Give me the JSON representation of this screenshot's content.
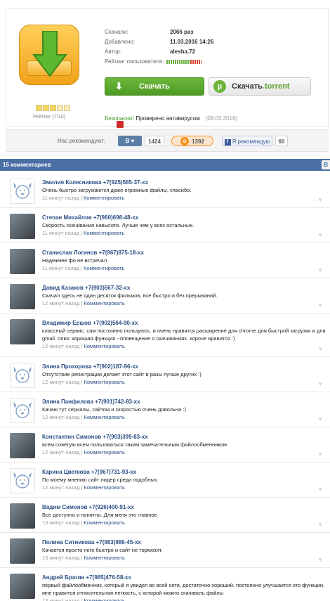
{
  "file": {
    "stats": [
      {
        "key": "Скачали:",
        "value": "2066 раз"
      },
      {
        "key": "Добавлено:",
        "value": "11.03.2016 14:26"
      },
      {
        "key": "Автор:",
        "value": "alesha.72"
      }
    ],
    "user_rating_label": "Рейтинг пользователя:",
    "user_rating_fraction": 0.7,
    "rating_text": "Рейтинг (7/10)",
    "rating_stars_on": 3,
    "rating_stars_total": 5
  },
  "buttons": {
    "download_label": "Скачать",
    "download_icon": "download-arrow-icon",
    "torrent_label_a": "Скачать ",
    "torrent_label_b": ".torrent",
    "torrent_icon": "utorrent-icon"
  },
  "safety": {
    "safe_word": "Безопасно!",
    "checked_text": "Проверено антивирусом",
    "date": "(08.03.2016)",
    "antivirus_colors": [
      "#d52b1e",
      "#f39c12",
      "#2eab4b",
      "#d22a2a"
    ]
  },
  "share": {
    "label": "Нас рекомендуют:",
    "vk_label": "В ♥",
    "vk_count": "1424",
    "ok_count": "1392",
    "fb_label": "Я рекомендую",
    "fb_count": "60"
  },
  "comments_header": {
    "title": "15 комментариев",
    "badge": "В"
  },
  "reply_label": "Комментировать",
  "comments": [
    {
      "name": "Эмилия Колесникова +7(925)585-37-xx",
      "text": "Очень быстро загружаются даже огромные файлы, спасибо.",
      "time": "11 минут назад",
      "avatar": "dog"
    },
    {
      "name": "Степан Михайлов +7(980)698-48-xx",
      "text": "Скорость скачивания навысоте. Лучше чем у всех остальных.",
      "time": "11 минут назад",
      "avatar": "photo"
    },
    {
      "name": "Станислав Логинов +7(967)875-18-xx",
      "text": "Надежнее фо не встречал",
      "time": "11 минут назад",
      "avatar": "photo"
    },
    {
      "name": "Давид Казаков +7(903)567-32-xx",
      "text": "Скачал здесь не один десяток фильмов, все быстро и без прерываний.",
      "time": "12 минут назад",
      "avatar": "photo"
    },
    {
      "name": "Владимир Ершов +7(902)564-90-xx",
      "text": "классный сервис. сам постоянно пользуюсь. и очень нравятся расширение для chrome для быстрой загрузки и для gmail. плюс хорошая функция - оповещение о скачиваниях. короче нравится :)",
      "time": "12 минут назад",
      "avatar": "photo"
    },
    {
      "name": "Элина Прохорова +7(902)187-96-xx",
      "text": "Отсутствие регистрации делает этот сайт в разы лучше других :)",
      "time": "12 минут назад",
      "avatar": "dog"
    },
    {
      "name": "Элина Панфилова +7(901)742-83-xx",
      "text": "Качаю тут сериалы, сайтом и скоростью очень довольна :)",
      "time": "12 минут назад",
      "avatar": "dog"
    },
    {
      "name": "Константин Симонов +7(903)399-83-xx",
      "text": "всем советую всем пользоваться таким замечательным файлообменником",
      "time": "12 минут назад",
      "avatar": "photo"
    },
    {
      "name": "Карина Цветкова +7(967)731-93-xx",
      "text": "По моему мнению сайт лидер среди подобных.",
      "time": "12 минут назад",
      "avatar": "dog"
    },
    {
      "name": "Вадим Симонов +7(926)400-91-xx",
      "text": "Все доступно и понятно. Для меня это главное",
      "time": "13 минут назад",
      "avatar": "photo"
    },
    {
      "name": "Полина Ситникова +7(983)986-45-xx",
      "text": "Качается просто него быстро и сайт не тормозит.",
      "time": "13 минут назад",
      "avatar": "photo"
    },
    {
      "name": "Андрей Брагин +7(985)476-58-xx",
      "text": "первый файлообменник, который я увидел во всей сети, достаточно хороший, постоянно улучшается его функции, мне нравится относительная легкость, с которой можно скачивать файлы",
      "time": "13 минут назад",
      "avatar": "photo"
    }
  ]
}
